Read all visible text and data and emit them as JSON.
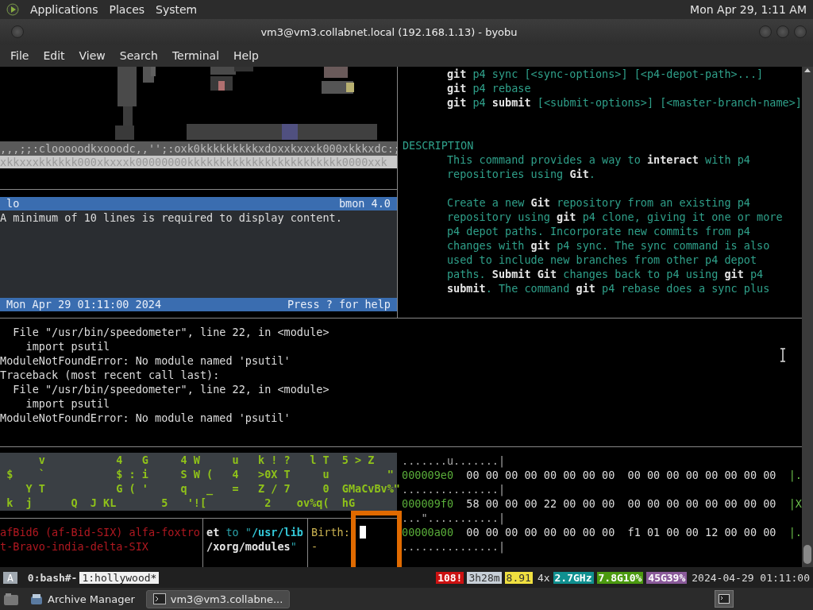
{
  "top_panel": {
    "menus": [
      "Applications",
      "Places",
      "System"
    ],
    "clock": "Mon Apr 29, 1:11 AM"
  },
  "window": {
    "title": "vm3@vm3.collabnet.local (192.168.1.13) - byobu"
  },
  "menu_bar": [
    "File",
    "Edit",
    "View",
    "Search",
    "Terminal",
    "Help"
  ],
  "ascii_art": {
    "lines": [
      ",,,;;:clooooodkxooodc,,'';:oxk0kkkkkkkkkxdoxxkxxxk000xkkkxdc:;",
      "xkkxxxkkkkkk000xkxxxk00000000kkkkkkkkkkkkkkkkkkkkkkkk0000xxk"
    ]
  },
  "bmon": {
    "interface": "lo",
    "version": "bmon 4.0",
    "message": "A minimum of 10 lines is required to display content.",
    "timestamp": "Mon Apr 29 01:11:00 2024",
    "help": "Press ? for help"
  },
  "man_page": {
    "synopsis": [
      "**git** p4 sync [<sync-options>] [<p4-depot-path>...]",
      "**git** p4 rebase",
      "**git** p4 **submit** [<submit-options>] [<master-branch-name>]"
    ],
    "heading": "DESCRIPTION",
    "paragraphs": [
      [
        "This command provides a way to **interact** with p4",
        "repositories using **Git**."
      ],
      [
        "Create a new **Git** repository from an existing p4",
        "repository using **git** p4 clone, giving it one or more",
        "p4 depot paths. Incorporate new commits from p4",
        "changes with **git** p4 sync. The sync command is also",
        "used to include new branches from other p4 depot",
        "paths. **Submit Git** changes back to p4 using **git** p4",
        "**submit**. The command **git** p4 rebase does a sync plus"
      ]
    ]
  },
  "traceback": [
    "  File \"/usr/bin/speedometer\", line 22, in <module>",
    "    import psutil",
    "ModuleNotFoundError: No module named 'psutil'",
    "Traceback (most recent call last):",
    "  File \"/usr/bin/speedometer\", line 22, in <module>",
    "    import psutil",
    "ModuleNotFoundError: No module named 'psutil'"
  ],
  "hollywood": {
    "rows": [
      "      v           4   G     4 W     u   k ! ?   l T  5 > Z",
      " $    `           $ : i     S W (   4   >0X T     u         \"",
      "    Y T           G ( '     q   _   =   Z / 7     0  GMaCvBv%\"",
      " k  j      Q  J KL       5   '![         2    ov%q(  hG"
    ]
  },
  "red_pane": [
    "afBid6 (af-Bid-SIX) alfa-foxtro",
    "t-Bravo-india-delta-SIX"
  ],
  "path_pane": [
    "**et** to \"**/usr/lib**",
    "**/xorg/modules**\""
  ],
  "stat_pane": {
    "label": "Birth:",
    "value": "-"
  },
  "hex_dump": [
    {
      "kind": "ascii",
      "text": ".......u.......|"
    },
    {
      "kind": "hex",
      "offset": "000009e0",
      "bytes": "00 00 00 00 00 00 00 00  00 00 00 00 00 00 00 00",
      "tail": "|."
    },
    {
      "kind": "ascii",
      "text": "...............|"
    },
    {
      "kind": "hex",
      "offset": "000009f0",
      "bytes": "58 00 00 00 22 00 00 00  00 00 00 00 00 00 00 00",
      "tail": "|X"
    },
    {
      "kind": "ascii",
      "text": "...\"...........|"
    },
    {
      "kind": "hex",
      "offset": "00000a00",
      "bytes": "00 00 00 00 00 00 00 00  f1 01 00 00 12 00 00 00",
      "tail": "|."
    },
    {
      "kind": "ascii",
      "text": "...............|"
    }
  ],
  "status_bar": {
    "session": "A",
    "windows": [
      {
        "label": "0:bash#-",
        "selected": false
      },
      {
        "label": "1:hollywood*",
        "selected": true
      }
    ],
    "segments": [
      {
        "text": "108!",
        "color": "#cc1111"
      },
      {
        "text": "3h28m",
        "color": "#c8d0d8"
      },
      {
        "text": "8.91",
        "color": "#f0e040"
      },
      {
        "text": "4x"
      },
      {
        "text": "2.7GHz",
        "color": "#109090"
      },
      {
        "text": "7.8G10%",
        "color": "#4c9a10"
      },
      {
        "text": "45G39%",
        "color": "#8a5a9a"
      },
      {
        "text": "2024-04-29 01:11:00"
      }
    ]
  },
  "taskbar": {
    "items": [
      {
        "label": "Archive Manager",
        "selected": false
      },
      {
        "label": "vm3@vm3.collabne...",
        "selected": true
      }
    ]
  }
}
